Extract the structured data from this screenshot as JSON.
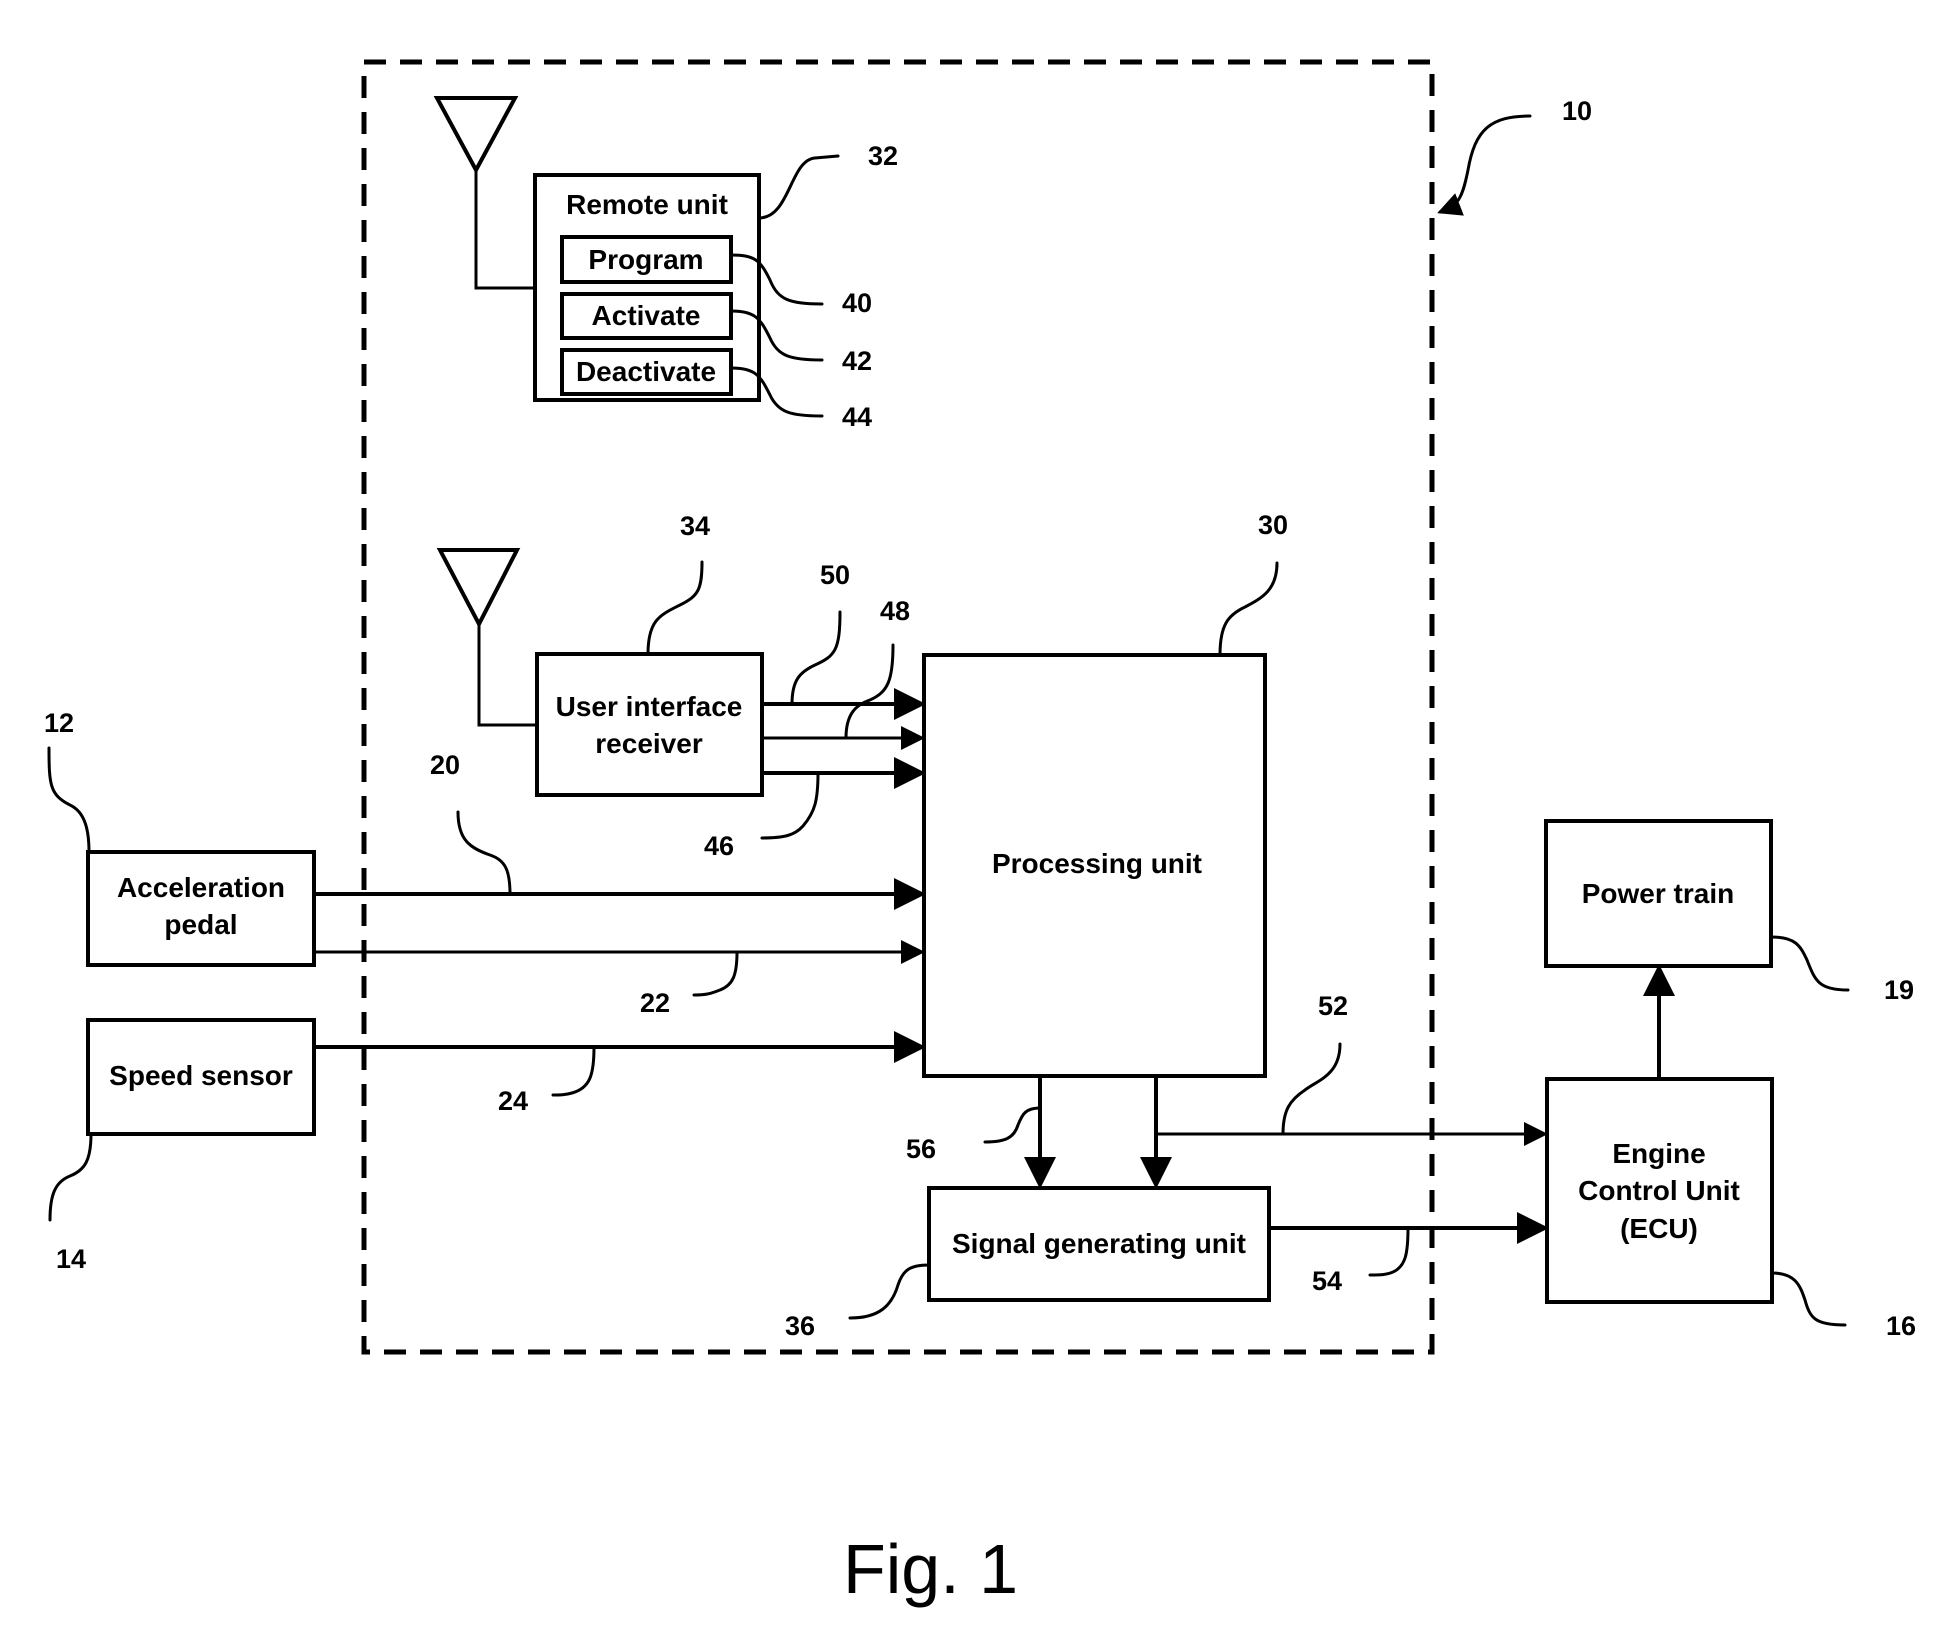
{
  "figure": {
    "caption": "Fig. 1",
    "system_ref": "10",
    "blocks": {
      "remote_unit": {
        "label": "Remote unit",
        "ref": "32"
      },
      "program": {
        "label": "Program",
        "ref": "40"
      },
      "activate": {
        "label": "Activate",
        "ref": "42"
      },
      "deactivate": {
        "label": "Deactivate",
        "ref": "44"
      },
      "ui_receiver": {
        "label_line1": "User interface",
        "label_line2": "receiver",
        "ref": "34"
      },
      "processing_unit": {
        "label": "Processing unit",
        "ref": "30"
      },
      "signal_generating_unit": {
        "label": "Signal generating unit",
        "ref": "36"
      },
      "acceleration_pedal": {
        "label_line1": "Acceleration",
        "label_line2": "pedal",
        "ref": "12"
      },
      "speed_sensor": {
        "label": "Speed sensor",
        "ref": "14"
      },
      "ecu": {
        "label_line1": "Engine",
        "label_line2": "Control Unit",
        "label_line3": "(ECU)",
        "ref": "16"
      },
      "power_train": {
        "label": "Power train",
        "ref": "19"
      }
    },
    "signals": {
      "s20": "20",
      "s22": "22",
      "s24": "24",
      "s46": "46",
      "s48": "48",
      "s50": "50",
      "s52": "52",
      "s54": "54",
      "s56": "56"
    }
  }
}
